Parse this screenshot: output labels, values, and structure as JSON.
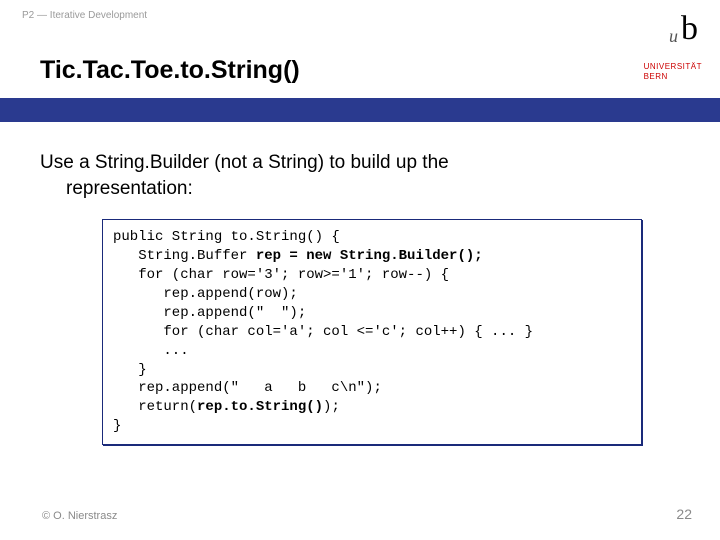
{
  "header": {
    "course_label": "P2 — Iterative Development",
    "slide_title": "Tic.Tac.Toe.to.String()"
  },
  "university": {
    "logo_small": "u",
    "logo_big": "b",
    "line1": "UNIVERSITÄT",
    "line2": "BERN"
  },
  "body": {
    "lead_line1": "Use a String.Builder (not a String) to build up the",
    "lead_line2": "representation:"
  },
  "code": {
    "l1": "public String to.String() {",
    "l2a": "   String.Buffer ",
    "l2b": "rep = new String.Builder();",
    "l3": "   for (char row='3'; row>='1'; row--) {",
    "l4": "      rep.append(row);",
    "l5": "      rep.append(\"  \");",
    "l6": "      for (char col='a'; col <='c'; col++) { ... }",
    "l7": "      ...",
    "l8": "   }",
    "l9": "   rep.append(\"   a   b   c\\n\");",
    "l10a": "   return(",
    "l10b": "rep.to.String()",
    "l10c": ");",
    "l11": "}"
  },
  "footer": {
    "copyright": "© O. Nierstrasz",
    "page": "22"
  }
}
